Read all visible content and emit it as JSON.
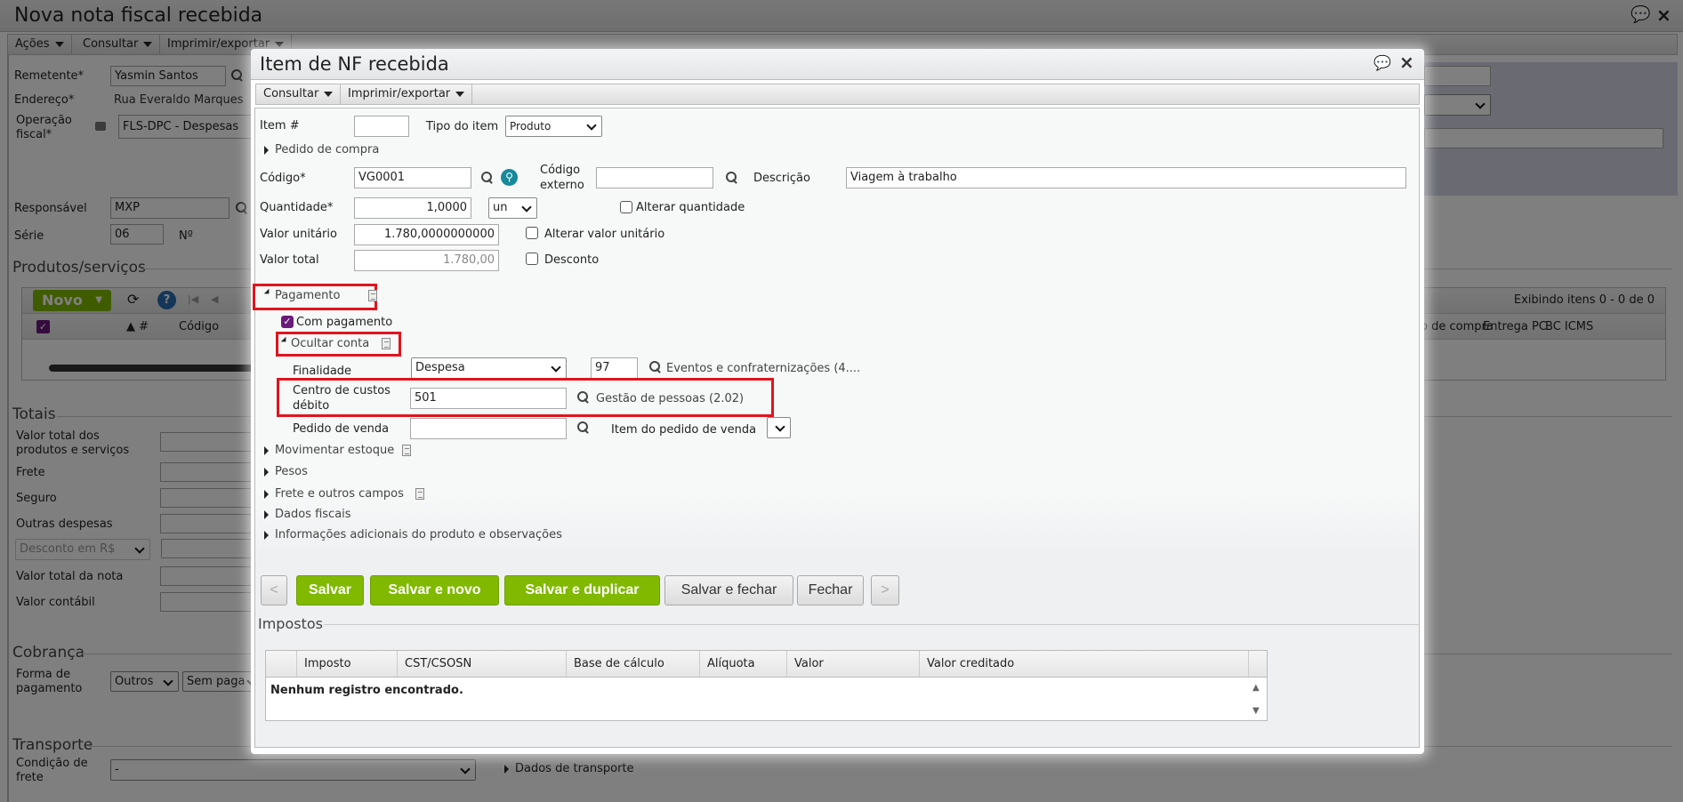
{
  "background": {
    "title": "Nova nota fiscal recebida",
    "menu": [
      "Ações",
      "Consultar",
      "Imprimir/exportar"
    ],
    "remetente_label": "Remetente*",
    "remetente_value": "Yasmin Santos",
    "endereco_label": "Endereço*",
    "endereco_value": "Rua Everaldo Marques",
    "operacao_label_1": "Operação",
    "operacao_label_2": "fiscal*",
    "operacao_value": "FLS-DPC - Despesas",
    "responsavel_label": "Responsável",
    "responsavel_value": "MXP",
    "serie_label": "Série",
    "serie_value": "06",
    "numero_label": "Nº",
    "produtos_legend": "Produtos/serviços",
    "novo_button": "Novo",
    "grid_status": "Exibindo itens 0 - 0 de 0",
    "grid_columns": [
      "▲ #",
      "Código",
      "o de compra",
      "Entrega PC",
      "BC ICMS"
    ],
    "totais_legend": "Totais",
    "totais": {
      "valor_total_produtos_1": "Valor total dos",
      "valor_total_produtos_2": "produtos e serviços",
      "frete": "Frete",
      "seguro": "Seguro",
      "outras_despesas": "Outras despesas",
      "desconto_select": "Desconto em R$",
      "valor_total_nota": "Valor total da nota",
      "valor_contabil": "Valor contábil"
    },
    "cobranca_legend": "Cobrança",
    "forma_pagamento_1": "Forma de",
    "forma_pagamento_2": "pagamento",
    "forma_pagamento_value": "Outros",
    "sem_pagamento_value": "Sem paga",
    "transporte_legend": "Transporte",
    "condicao_frete_1": "Condição de",
    "condicao_frete_2": "frete",
    "condicao_frete_value": "-",
    "dados_transporte": "Dados de transporte"
  },
  "modal": {
    "title": "Item de NF recebida",
    "menu": [
      "Consultar",
      "Imprimir/exportar"
    ],
    "item_label": "Item #",
    "item_value": "",
    "tipo_label": "Tipo do item",
    "tipo_value": "Produto",
    "pedido_compra": "Pedido de compra",
    "codigo_label": "Código*",
    "codigo_value": "VG0001",
    "codigo_externo_1": "Código",
    "codigo_externo_2": "externo",
    "codigo_externo_value": "",
    "descricao_label": "Descrição",
    "descricao_value": "Viagem à trabalho",
    "quantidade_label": "Quantidade*",
    "quantidade_value": "1,0000",
    "unidade_value": "un",
    "alterar_quantidade": "Alterar quantidade",
    "valor_unitario_label": "Valor unitário",
    "valor_unitario_value": "1.780,0000000000",
    "alterar_valor_unitario": "Alterar valor unitário",
    "valor_total_label": "Valor total",
    "valor_total_value": "1.780,00",
    "desconto": "Desconto",
    "pagamento": "Pagamento",
    "com_pagamento": "Com pagamento",
    "ocultar_conta": "Ocultar conta",
    "finalidade_label": "Finalidade",
    "finalidade_value": "Despesa",
    "conta_value": "97",
    "conta_desc": "Eventos e confraternizações (4....",
    "centro_label_1": "Centro de custos",
    "centro_label_2": "débito",
    "centro_value": "501",
    "centro_desc": "Gestão de pessoas (2.02)",
    "pedido_venda_label": "Pedido de venda",
    "pedido_venda_value": "",
    "item_pedido_venda_label": "Item do pedido de venda",
    "sections": [
      "Movimentar estoque",
      "Pesos",
      "Frete e outros campos",
      "Dados fiscais",
      "Informações adicionais do produto e observações"
    ],
    "buttons": {
      "prev": "<",
      "salvar": "Salvar",
      "salvar_novo": "Salvar e novo",
      "salvar_duplicar": "Salvar e duplicar",
      "salvar_fechar": "Salvar e fechar",
      "fechar": "Fechar",
      "next": ">"
    },
    "impostos_legend": "Impostos",
    "impostos_columns": [
      "Imposto",
      "CST/CSOSN",
      "Base de cálculo",
      "Alíquota",
      "Valor",
      "Valor creditado"
    ],
    "impostos_empty": "Nenhum registro encontrado."
  },
  "colors": {
    "accent_green": "#80b900",
    "highlight_red": "#e0141e",
    "checkbox_purple": "#6a1b7a"
  }
}
